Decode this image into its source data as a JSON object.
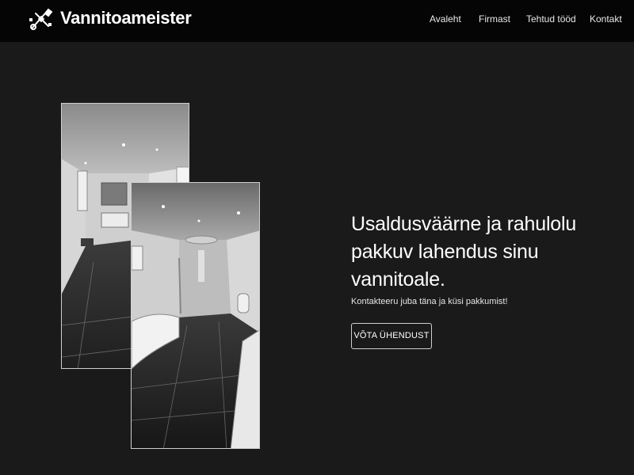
{
  "header": {
    "brand": "Vannitoameister",
    "logo_icon": "wrench-tools-icon",
    "nav": [
      {
        "label": "Avaleht"
      },
      {
        "label": "Firmast"
      },
      {
        "label": "Tehtud tööd"
      },
      {
        "label": "Kontakt"
      }
    ]
  },
  "hero": {
    "title": "Usaldusväärne ja rahulolu pakkuv lahendus sinu vannitoale.",
    "subtitle": "Kontakteeru juba täna ja küsi pakkumist!",
    "cta_label": "VÕTA ÜHENDUST"
  },
  "gallery": {
    "photos": [
      {
        "name": "bathroom-photo-vanity"
      },
      {
        "name": "bathroom-photo-bathtub"
      }
    ]
  },
  "colors": {
    "background": "#1a1a1a",
    "header_background": "#050505",
    "text": "#ffffff",
    "border": "#cfcfcf"
  }
}
